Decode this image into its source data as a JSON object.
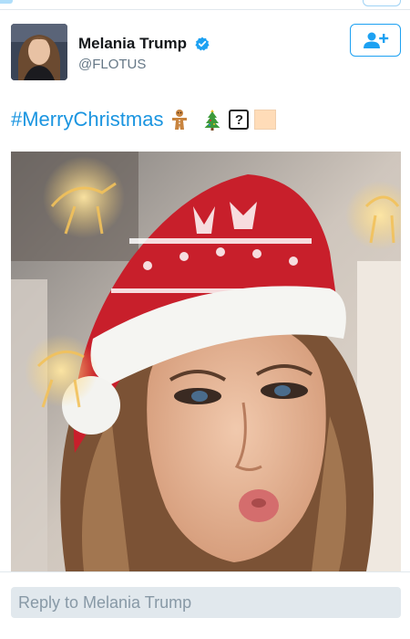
{
  "tweet": {
    "author": {
      "display_name": "Melania Trump",
      "handle": "@FLOTUS",
      "verified": true,
      "avatar_icon": "profile-photo"
    },
    "follow_button": {
      "icon": "add-user-icon"
    },
    "text": {
      "hashtag": "#MerryChristmas",
      "emojis": [
        "gingerbread-man",
        "christmas-tree",
        "unknown-glyph",
        "skin-tone-modifier"
      ],
      "unknown_glyph": "?"
    },
    "media": {
      "type": "photo",
      "description_icon": "photo-santa-hat-selfie"
    }
  },
  "reply": {
    "placeholder": "Reply to Melania Trump"
  },
  "colors": {
    "brand": "#1da1f2",
    "hashtag": "#1b95e0",
    "name": "#14171a",
    "secondary": "#657786",
    "reply_bg": "#e1e8ed"
  }
}
